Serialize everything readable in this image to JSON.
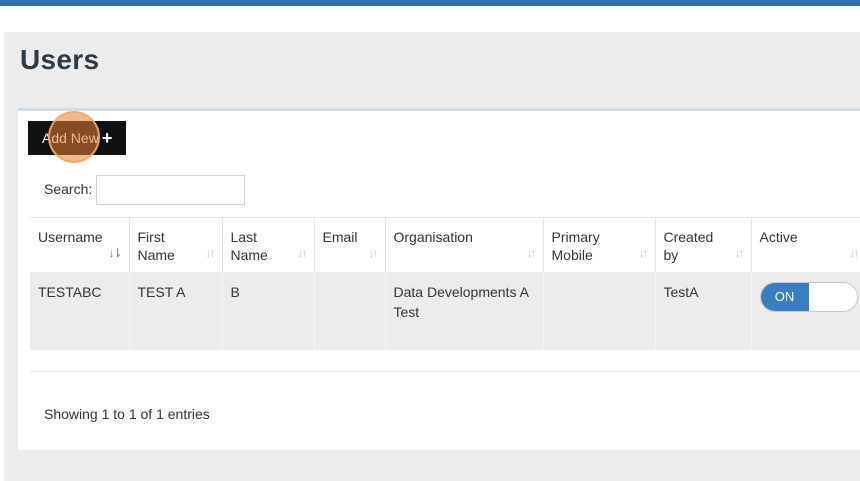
{
  "page": {
    "title": "Users"
  },
  "toolbar": {
    "add_new_label": "Add New",
    "add_new_icon": "plus-icon"
  },
  "search": {
    "label": "Search:",
    "value": "",
    "placeholder": ""
  },
  "table": {
    "columns": [
      {
        "line1": "Username",
        "line2": "",
        "sort": "sorted-ascending"
      },
      {
        "line1": "First",
        "line2": "Name",
        "sort": "sortable"
      },
      {
        "line1": "Last",
        "line2": "Name",
        "sort": "sortable"
      },
      {
        "line1": "Email",
        "line2": "",
        "sort": "sortable"
      },
      {
        "line1": "Organisation",
        "line2": "",
        "sort": "sortable"
      },
      {
        "line1": "Primary",
        "line2": "Mobile",
        "sort": "sortable"
      },
      {
        "line1": "Created",
        "line2": "by",
        "sort": "sortable"
      },
      {
        "line1": "Active",
        "line2": "",
        "sort": "sortable"
      }
    ],
    "rows": [
      {
        "username": "TESTABC",
        "first_name": "TEST A",
        "last_name": "B",
        "email": "",
        "organisation": "Data Developments A Test",
        "primary_mobile": "",
        "created_by": "TestA",
        "active": "ON"
      }
    ]
  },
  "footer": {
    "info": "Showing 1 to 1 of 1 entries"
  },
  "colors": {
    "accent": "#2f6fae",
    "toggle_on": "#3a7ebf",
    "button_bg": "#111111"
  }
}
